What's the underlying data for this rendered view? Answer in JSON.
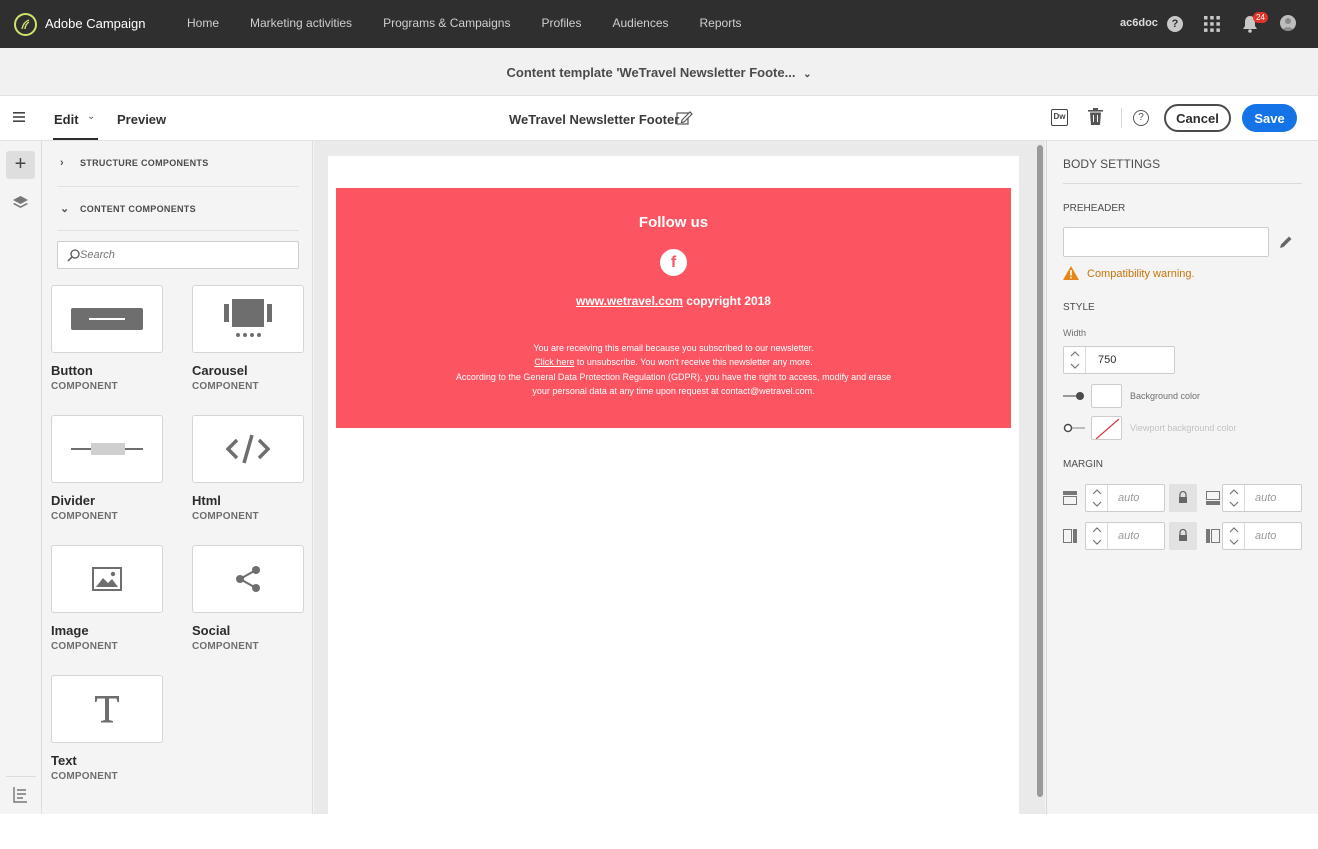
{
  "app": {
    "name": "Adobe Campaign",
    "user": "ac6doc",
    "notification_count": "24",
    "nav": [
      "Home",
      "Marketing activities",
      "Programs & Campaigns",
      "Profiles",
      "Audiences",
      "Reports"
    ]
  },
  "titlebar": {
    "title": "Content template 'WeTravel Newsletter Foote..."
  },
  "toolbar": {
    "tab_edit": "Edit",
    "tab_preview": "Preview",
    "document_title": "WeTravel Newsletter Footer",
    "dw_label": "Dw",
    "help_label": "?",
    "cancel_label": "Cancel",
    "save_label": "Save"
  },
  "rail": {
    "add_label": "+"
  },
  "components_panel": {
    "structure_title": "STRUCTURE COMPONENTS",
    "content_title": "CONTENT COMPONENTS",
    "search_placeholder": "Search",
    "items": [
      {
        "name": "Button",
        "type": "COMPONENT",
        "icon": "button-icon"
      },
      {
        "name": "Carousel",
        "type": "COMPONENT",
        "icon": "carousel-icon"
      },
      {
        "name": "Divider",
        "type": "COMPONENT",
        "icon": "divider-icon"
      },
      {
        "name": "Html",
        "type": "COMPONENT",
        "icon": "html-icon"
      },
      {
        "name": "Image",
        "type": "COMPONENT",
        "icon": "image-icon"
      },
      {
        "name": "Social",
        "type": "COMPONENT",
        "icon": "share-icon"
      },
      {
        "name": "Text",
        "type": "COMPONENT",
        "icon": "text-icon"
      }
    ]
  },
  "email": {
    "background_color": "#fc5561",
    "follow_title": "Follow us",
    "facebook_glyph": "f",
    "site_link": "www.wetravel.com",
    "copyright": " copyright 2018",
    "legal_line1": "You are receiving this email because you subscribed to our newsletter.",
    "unsubscribe_link": "Click here",
    "legal_line2_rest": " to unsubscribe. You won't receive this newsletter any more.",
    "legal_line3": "According to the General Data Protection Regulation (GDPR), you have the right to access, modify and erase",
    "legal_line4": "your personal data at any time upon request at contact@wetravel.com."
  },
  "body_settings": {
    "title": "BODY SETTINGS",
    "preheader_label": "PREHEADER",
    "preheader_value": "",
    "warning_text": "Compatibility warning.",
    "style_label": "STYLE",
    "width_label": "Width",
    "width_value": "750",
    "background_color_label": "Background color",
    "viewport_color_label": "Viewport background color",
    "margin_label": "MARGIN",
    "margins": [
      "auto",
      "auto",
      "auto",
      "auto"
    ]
  },
  "colors": {
    "accent": "#1473e6",
    "topbar": "#2f2f2f",
    "warning": "#c8740a",
    "badge": "#e0342b"
  }
}
